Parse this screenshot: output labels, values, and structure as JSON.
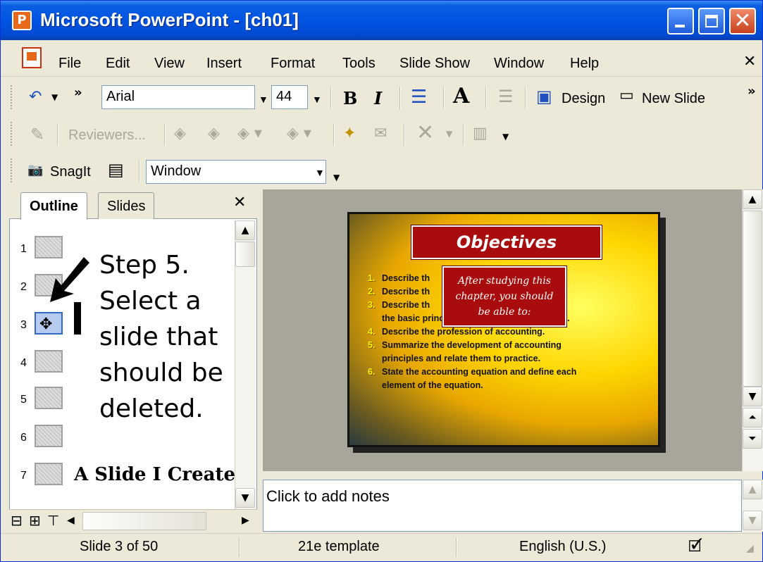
{
  "window": {
    "app_icon": "powerpoint-icon",
    "title": "Microsoft PowerPoint - [ch01]"
  },
  "menu": {
    "items": [
      "File",
      "Edit",
      "View",
      "Insert",
      "Format",
      "Tools",
      "Slide Show",
      "Window",
      "Help"
    ]
  },
  "formatting_toolbar": {
    "font": "Arial",
    "size": "44",
    "design_label": "Design",
    "new_slide_label": "New Slide"
  },
  "reviewing_toolbar": {
    "reviewers_label": "Reviewers..."
  },
  "snagit_toolbar": {
    "snagit_label": "SnagIt",
    "capture_mode": "Window"
  },
  "left_pane": {
    "tabs": [
      {
        "label": "Outline",
        "active": true
      },
      {
        "label": "Slides",
        "active": false
      }
    ],
    "rows": [
      {
        "num": "1",
        "title": ""
      },
      {
        "num": "2",
        "title": ""
      },
      {
        "num": "3",
        "title": "",
        "selected": true
      },
      {
        "num": "4",
        "title": ""
      },
      {
        "num": "5",
        "title": ""
      },
      {
        "num": "6",
        "title": ""
      },
      {
        "num": "7",
        "title": "A Slide I Created"
      }
    ],
    "instruction_lines": [
      "Step 5.",
      "Select a",
      "slide that",
      "should be",
      "deleted."
    ]
  },
  "slide": {
    "title": "Objectives",
    "callout_lines": [
      "After studying this",
      "chapter, you should",
      "be able to:"
    ],
    "items": [
      {
        "num": "1.",
        "text": "Describe th"
      },
      {
        "num": "2.",
        "text": "Describe th                              siness."
      },
      {
        "num": "3.",
        "text": "Describe th                              ethics and"
      },
      {
        "num": "",
        "text": "the basic principle of proper ethical conduct."
      },
      {
        "num": "4.",
        "text": "Describe the profession of accounting."
      },
      {
        "num": "5.",
        "text": "Summarize the development of accounting"
      },
      {
        "num": "",
        "text": "principles and relate them to practice."
      },
      {
        "num": "6.",
        "text": "State the accounting equation and define each"
      },
      {
        "num": "",
        "text": "element of the equation."
      }
    ]
  },
  "notes": {
    "placeholder": "Click to add notes"
  },
  "status": {
    "slide_position": "Slide 3 of 50",
    "template": "21e template",
    "language": "English (U.S.)"
  },
  "colors": {
    "titlebar": "#0054e3",
    "chrome": "#ece9d8",
    "slide_title_fill": "#a80c0c",
    "slide_background": "#ffd500"
  }
}
